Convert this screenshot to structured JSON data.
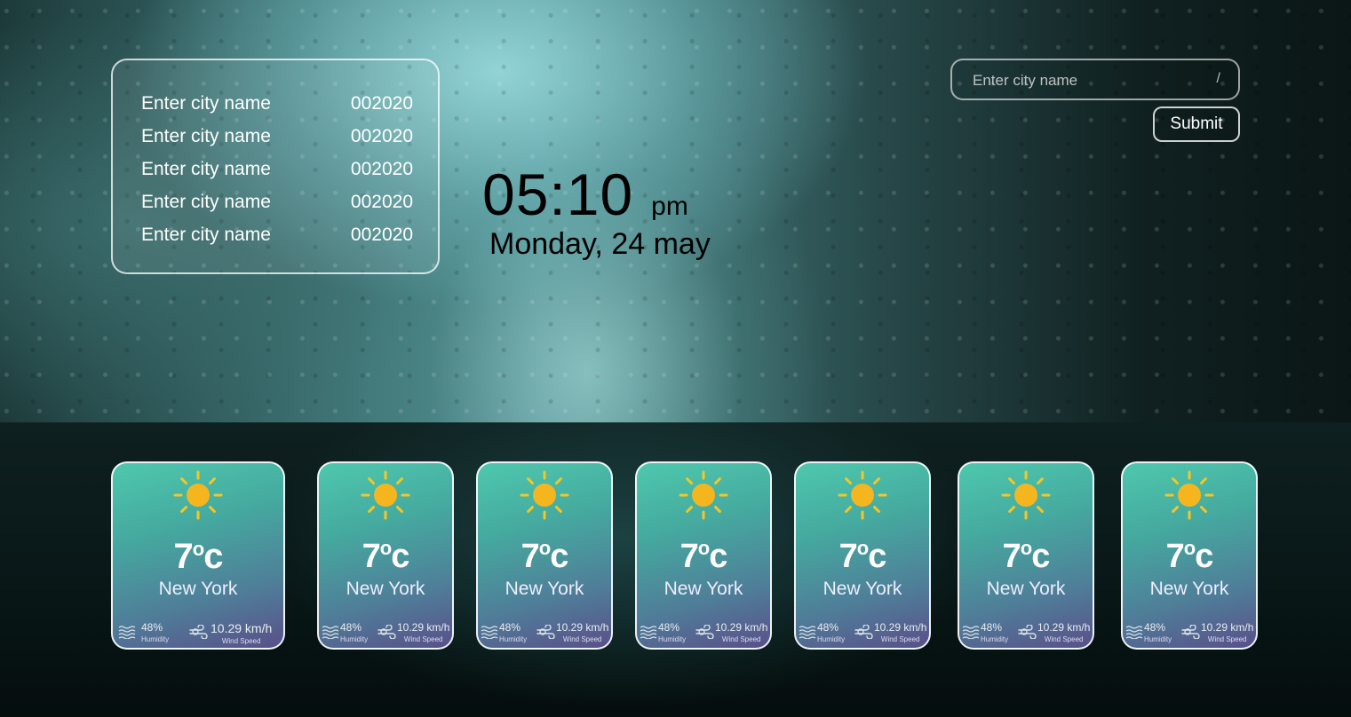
{
  "history": [
    {
      "city": "Enter city name",
      "code": "002020"
    },
    {
      "city": "Enter city name",
      "code": "002020"
    },
    {
      "city": "Enter city name",
      "code": "002020"
    },
    {
      "city": "Enter city name",
      "code": "002020"
    },
    {
      "city": "Enter city name",
      "code": "002020"
    }
  ],
  "clock": {
    "time": "05:10",
    "ampm": "pm",
    "date": "Monday, 24 may"
  },
  "search": {
    "placeholder": "Enter city name",
    "shortcut": "/",
    "submit_label": "Submit"
  },
  "cards": [
    {
      "temp": "7",
      "unit_deg": "o",
      "unit": "c",
      "city": "New York",
      "humidity": "48%",
      "humidity_label": "Humidity",
      "wind": "10.29 km/h",
      "wind_label": "Wind Speed",
      "icon": "sun-icon"
    },
    {
      "temp": "7",
      "unit_deg": "o",
      "unit": "c",
      "city": "New York",
      "humidity": "48%",
      "humidity_label": "Humidity",
      "wind": "10.29 km/h",
      "wind_label": "Wind Speed",
      "icon": "sun-icon"
    },
    {
      "temp": "7",
      "unit_deg": "o",
      "unit": "c",
      "city": "New York",
      "humidity": "48%",
      "humidity_label": "Humidity",
      "wind": "10.29 km/h",
      "wind_label": "Wind Speed",
      "icon": "sun-icon"
    },
    {
      "temp": "7",
      "unit_deg": "o",
      "unit": "c",
      "city": "New York",
      "humidity": "48%",
      "humidity_label": "Humidity",
      "wind": "10.29 km/h",
      "wind_label": "Wind Speed",
      "icon": "sun-icon"
    },
    {
      "temp": "7",
      "unit_deg": "o",
      "unit": "c",
      "city": "New York",
      "humidity": "48%",
      "humidity_label": "Humidity",
      "wind": "10.29 km/h",
      "wind_label": "Wind Speed",
      "icon": "sun-icon"
    },
    {
      "temp": "7",
      "unit_deg": "o",
      "unit": "c",
      "city": "New York",
      "humidity": "48%",
      "humidity_label": "Humidity",
      "wind": "10.29 km/h",
      "wind_label": "Wind Speed",
      "icon": "sun-icon"
    },
    {
      "temp": "7",
      "unit_deg": "o",
      "unit": "c",
      "city": "New York",
      "humidity": "48%",
      "humidity_label": "Humidity",
      "wind": "10.29 km/h",
      "wind_label": "Wind Speed",
      "icon": "sun-icon"
    }
  ],
  "colors": {
    "sun": "#f5b51f",
    "sun_rays": "#f6c623",
    "card_top": "#4ec8ad",
    "card_bottom": "#59508a"
  }
}
